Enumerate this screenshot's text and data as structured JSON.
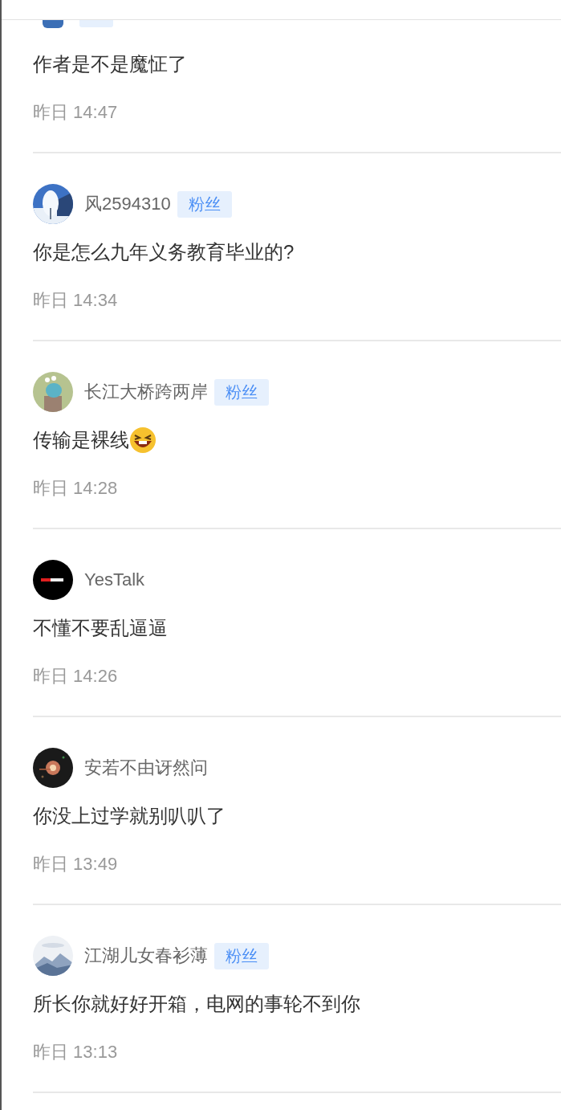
{
  "comments": [
    {
      "fan": true,
      "text": "作者是不是魔怔了",
      "time": "昨日 14:47"
    },
    {
      "name": "风2594310",
      "fan": true,
      "badge": "粉丝",
      "text": "你是怎么九年义务教育毕业的?",
      "time": "昨日 14:34"
    },
    {
      "name": "长江大桥跨两岸",
      "fan": true,
      "badge": "粉丝",
      "text": "传输是裸线",
      "emoji": true,
      "time": "昨日 14:28"
    },
    {
      "name": "YesTalk",
      "fan": false,
      "text": "不懂不要乱逼逼",
      "time": "昨日 14:26"
    },
    {
      "name": "安若不由讶然问",
      "fan": false,
      "text": "你没上过学就别叭叭了",
      "time": "昨日 13:49"
    },
    {
      "name": "江湖儿女春衫薄",
      "fan": true,
      "badge": "粉丝",
      "text": "所长你就好好开箱，电网的事轮不到你",
      "time": "昨日 13:13"
    }
  ]
}
